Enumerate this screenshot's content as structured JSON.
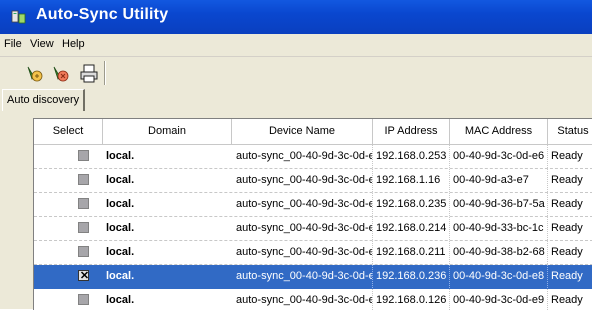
{
  "app": {
    "title": "Auto-Sync Utility"
  },
  "menu": {
    "items": [
      "File",
      "View",
      "Help"
    ]
  },
  "toolbar": {
    "buttons": [
      "discover-icon",
      "sync-icon",
      "print-icon"
    ]
  },
  "tabs": {
    "active": "Auto discovery"
  },
  "table": {
    "headers": {
      "select": "Select",
      "domain": "Domain",
      "device": "Device Name",
      "ip": "IP Address",
      "mac": "MAC Address",
      "status": "Status"
    },
    "rows": [
      {
        "checked": false,
        "domain": "local.",
        "device": "auto-sync_00-40-9d-3c-0d-e",
        "ip": "192.168.0.253",
        "mac": "00-40-9d-3c-0d-e6",
        "status": "Ready"
      },
      {
        "checked": false,
        "domain": "local.",
        "device": "auto-sync_00-40-9d-3c-0d-e",
        "ip": "192.168.1.16",
        "mac": "00-40-9d-a3-e7",
        "status": "Ready"
      },
      {
        "checked": false,
        "domain": "local.",
        "device": "auto-sync_00-40-9d-3c-0d-e",
        "ip": "192.168.0.235",
        "mac": "00-40-9d-36-b7-5a",
        "status": "Ready"
      },
      {
        "checked": false,
        "domain": "local.",
        "device": "auto-sync_00-40-9d-3c-0d-e",
        "ip": "192.168.0.214",
        "mac": "00-40-9d-33-bc-1c",
        "status": "Ready"
      },
      {
        "checked": false,
        "domain": "local.",
        "device": "auto-sync_00-40-9d-3c-0d-e",
        "ip": "192.168.0.211",
        "mac": "00-40-9d-38-b2-68",
        "status": "Ready"
      },
      {
        "checked": true,
        "selected": true,
        "domain": "local.",
        "device": "auto-sync_00-40-9d-3c-0d-e(",
        "ip": "192.168.0.236",
        "mac": "00-40-9d-3c-0d-e8",
        "status": "Ready"
      },
      {
        "checked": false,
        "domain": "local.",
        "device": "auto-sync_00-40-9d-3c-0d-e",
        "ip": "192.168.0.126",
        "mac": "00-40-9d-3c-0d-e9",
        "status": "Ready"
      }
    ]
  },
  "colors": {
    "title_bar": "#0a47cf",
    "selection": "#316ac5",
    "chrome": "#ece9d8"
  }
}
